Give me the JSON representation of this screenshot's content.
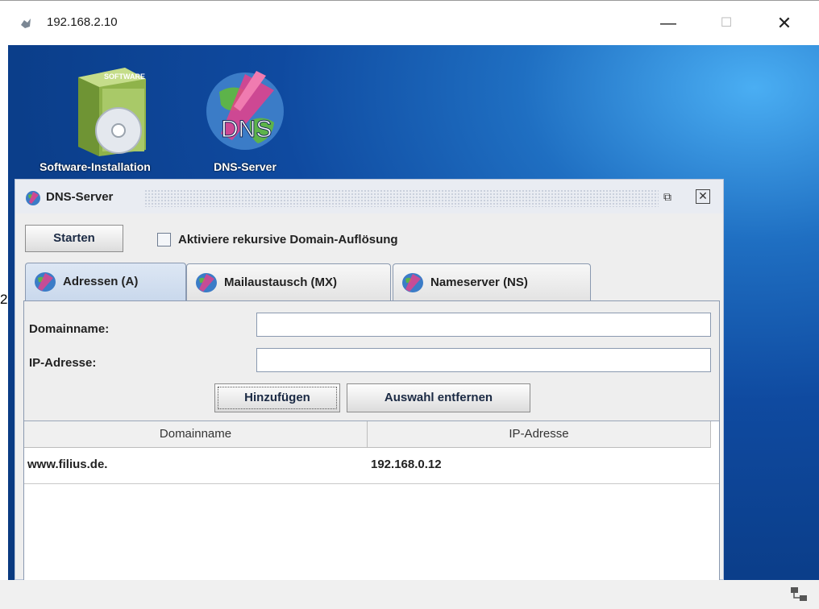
{
  "window": {
    "title": "192.168.2.10",
    "min_label": "—",
    "max_label": "☐",
    "close_label": "✕"
  },
  "desktop": {
    "icons": [
      {
        "label": "Software-Installation",
        "icon": "software-box-icon"
      },
      {
        "label": "DNS-Server",
        "icon": "dns-globe-icon"
      }
    ],
    "stray_char": "2"
  },
  "dns_window": {
    "title": "DNS-Server",
    "start_button": "Starten",
    "recursive_label": "Aktiviere rekursive Domain-Auflösung",
    "recursive_checked": false,
    "tabs": [
      {
        "label": "Adressen (A)",
        "active": true
      },
      {
        "label": "Mailaustausch (MX)",
        "active": false
      },
      {
        "label": "Nameserver (NS)",
        "active": false
      }
    ],
    "form": {
      "domain_label": "Domainname:",
      "domain_value": "",
      "ip_label": "IP-Adresse:",
      "ip_value": "",
      "add_button": "Hinzufügen",
      "remove_button": "Auswahl entfernen"
    },
    "table": {
      "columns": [
        "Domainname",
        "IP-Adresse"
      ],
      "rows": [
        [
          "www.filius.de.",
          "192.168.0.12"
        ]
      ]
    }
  },
  "colors": {
    "desktop_blue": "#0f4aa0",
    "desktop_highlight": "#4aaef3",
    "tab_active": "#c9d8ec"
  }
}
